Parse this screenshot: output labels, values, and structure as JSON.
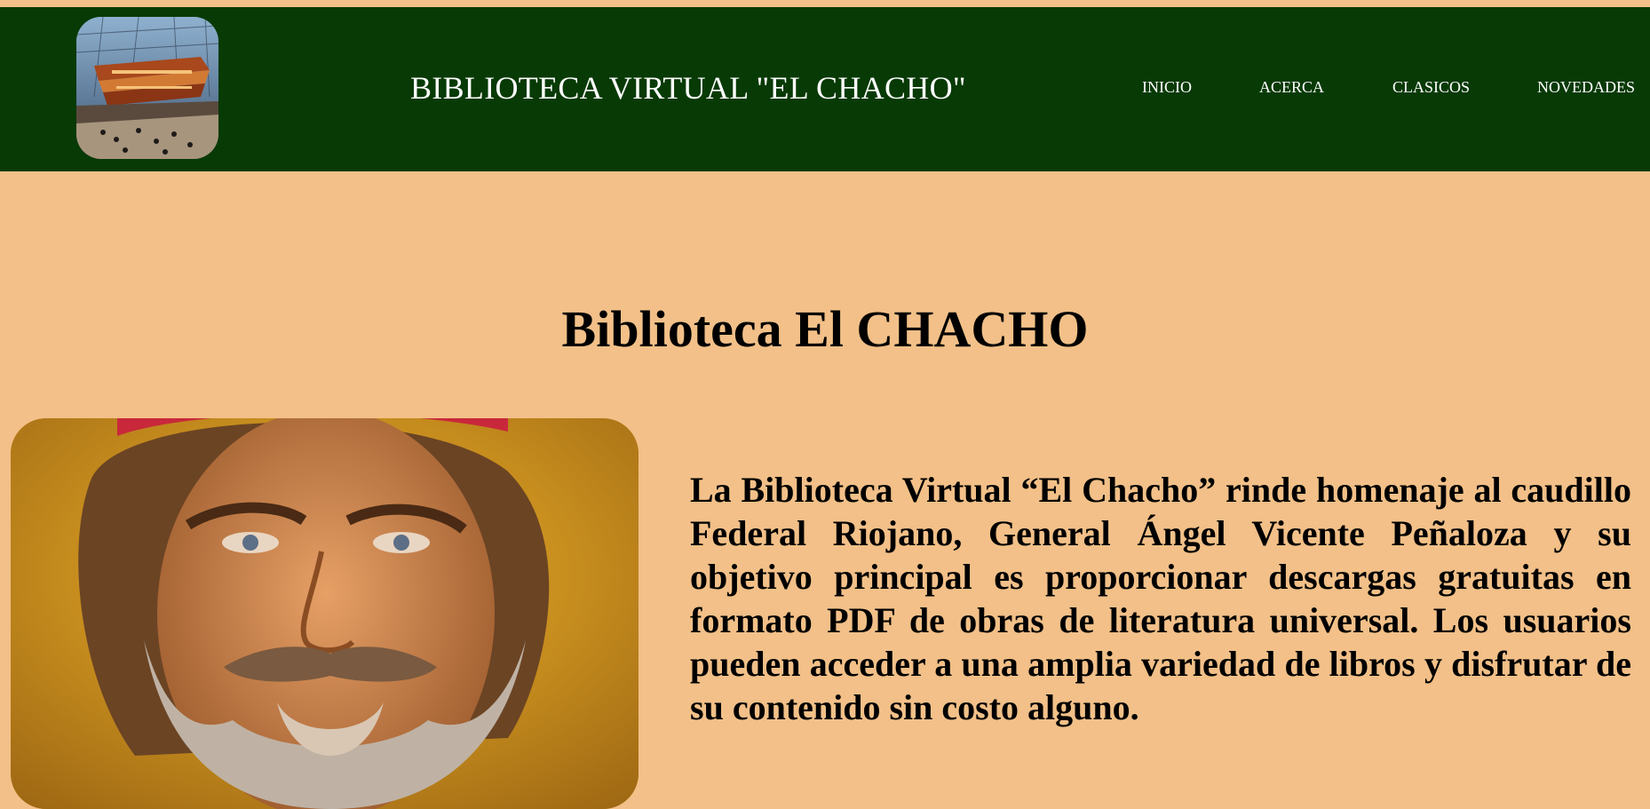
{
  "header": {
    "site_title": "BIBLIOTECA VIRTUAL \"EL CHACHO\"",
    "logo_icon": "library-building-image",
    "background_color": "#083a06"
  },
  "nav": {
    "items": [
      {
        "label": "INICIO"
      },
      {
        "label": "ACERCA"
      },
      {
        "label": "CLASICOS"
      },
      {
        "label": "NOVEDADES"
      }
    ]
  },
  "main": {
    "heading": "Biblioteca El CHACHO",
    "hero_image": "portrait-el-chacho-image",
    "description": "La Biblioteca Virtual “El Chacho” rinde homenaje al caudillo Federal Riojano, General Ángel Vicente Peñaloza y su objetivo principal es proporcionar descargas gratuitas en formato PDF de obras de literatura universal. Los usuarios pueden acceder a una amplia variedad de libros y disfrutar de su contenido sin costo alguno.",
    "background_color": "#f2c088"
  }
}
